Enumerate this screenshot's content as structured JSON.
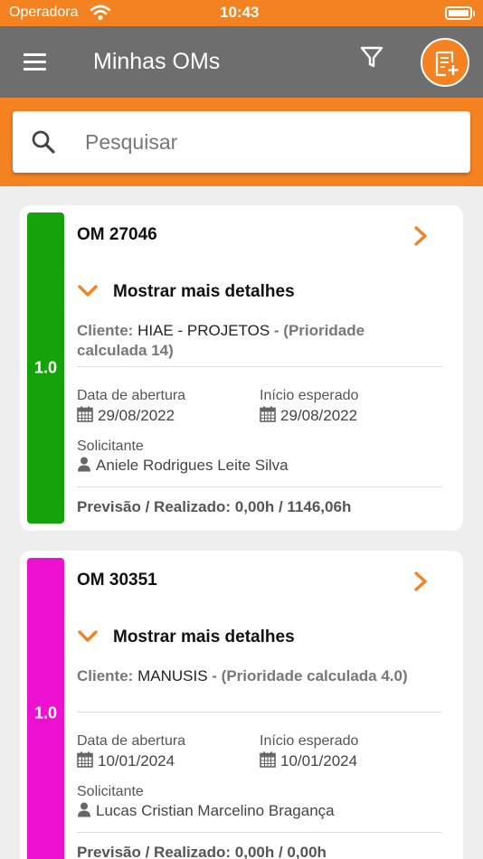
{
  "status_bar": {
    "carrier": "Operadora",
    "time": "10:43"
  },
  "header": {
    "title": "Minhas OMs",
    "icons": [
      "menu-icon",
      "filter-icon",
      "add-om-icon"
    ]
  },
  "search": {
    "placeholder": "Pesquisar",
    "value": ""
  },
  "colors": {
    "brand_orange": "#f58220",
    "header_gray": "#6e6e6e"
  },
  "orders": [
    {
      "priority": "1.0",
      "priority_color": "#14a30b",
      "number": "OM 27046",
      "details_toggle": "Mostrar mais detalhes",
      "client_label": "Cliente:",
      "client_name": "HIAE - PROJETOS",
      "client_priority": "- (Prioridade calculada 14)",
      "opening_date_label": "Data de abertura",
      "opening_date": "29/08/2022",
      "expected_start_label": "Início esperado",
      "expected_start": "29/08/2022",
      "requester_label": "Solicitante",
      "requester": "Aniele Rodrigues Leite Silva",
      "forecast": "Previsão / Realizado: 0,00h / 1146,06h"
    },
    {
      "priority": "1.0",
      "priority_color": "#ee10d0",
      "number": "OM 30351",
      "details_toggle": "Mostrar mais detalhes",
      "client_label": "Cliente:",
      "client_name": "MANUSIS",
      "client_priority": "- (Prioridade calculada 4.0)",
      "opening_date_label": "Data de abertura",
      "opening_date": "10/01/2024",
      "expected_start_label": "Início esperado",
      "expected_start": "10/01/2024",
      "requester_label": "Solicitante",
      "requester": "Lucas Cristian Marcelino Bragança",
      "forecast": "Previsão / Realizado: 0,00h / 0,00h"
    }
  ]
}
